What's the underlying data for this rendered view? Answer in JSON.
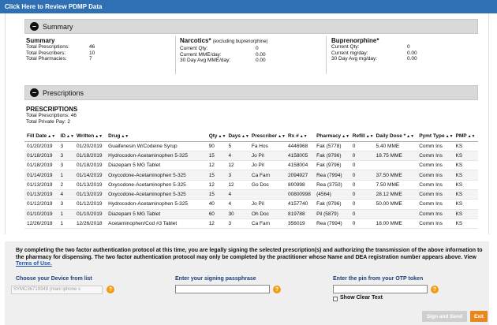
{
  "header": {
    "title": "Click Here to Review PDMP Data"
  },
  "summary_section": {
    "label": "Summary",
    "summary": {
      "title": "Summary",
      "rows": [
        {
          "k": "Total Prescriptions:",
          "v": "46"
        },
        {
          "k": "Total Prescribers:",
          "v": "10"
        },
        {
          "k": "Total Pharmacies:",
          "v": "7"
        }
      ]
    },
    "narcotics": {
      "title": "Narcotics*",
      "note": "(excluding buprenorphine)",
      "rows": [
        {
          "k": "Current Qty:",
          "v": "0"
        },
        {
          "k": "Current MME/day:",
          "v": "0.00"
        },
        {
          "k": "30 Day Avg MME/day:",
          "v": "0.00"
        }
      ]
    },
    "buprenorphine": {
      "title": "Buprenorphine*",
      "rows": [
        {
          "k": "Current Qty:",
          "v": "0"
        },
        {
          "k": "Current mg/day:",
          "v": "0.00"
        },
        {
          "k": "30 Day Avg mg/day:",
          "v": "0.00"
        }
      ]
    }
  },
  "prescriptions_section": {
    "label": "Prescriptions",
    "title": "PRESCRIPTIONS",
    "total_prescriptions": "Total Prescriptions: 46",
    "total_private_pay": "Total Private Pay:  2",
    "columns": [
      "Fill Date",
      "ID",
      "Written",
      "Drug",
      "Qty",
      "Days",
      "Prescriber",
      "Rx #",
      "Pharmacy",
      "Refill",
      "Daily Dose *",
      "Pymt Type",
      "PMP"
    ],
    "rows": [
      [
        "01/20/2019",
        "3",
        "01/20/2019",
        "Guaifenesin W/Codeine Syrup",
        "90",
        "5",
        "Fa Hos",
        "4446968",
        "Fak (5778)",
        "0",
        "5.40 MME",
        "Comm Ins",
        "KS"
      ],
      [
        "01/18/2019",
        "3",
        "01/18/2019",
        "Hydrocodon-Acetaminophen 5-325",
        "15",
        "4",
        "Jo Pil",
        "4158005",
        "Fak (9796)",
        "0",
        "18.75 MME",
        "Comm Ins",
        "KS"
      ],
      [
        "01/18/2019",
        "3",
        "01/18/2019",
        "Diazepam 5 MG Tablet",
        "12",
        "12",
        "Jo Pil",
        "4158004",
        "Fak (9796)",
        "0",
        "",
        "Comm Ins",
        "KS"
      ],
      [
        "01/14/2019",
        "1",
        "01/14/2019",
        "Oxycodone-Acetaminophen 5-325",
        "15",
        "3",
        "Ca Fam",
        "2094927",
        "Rea (7994)",
        "0",
        "37.50 MME",
        "Comm Ins",
        "KS"
      ],
      [
        "01/13/2019",
        "2",
        "01/13/2019",
        "Oxycodone-Acetaminophen 5-325",
        "12",
        "12",
        "Go Doc",
        "800998",
        "Rea (3750)",
        "0",
        "7.50 MME",
        "Comm Ins",
        "KS"
      ],
      [
        "01/13/2019",
        "4",
        "01/13/2019",
        "Oxycodone-Acetaminophen 5-325",
        "15",
        "4",
        "",
        "00800998",
        "(4564)",
        "0",
        "28.12 MME",
        "Comm Ins",
        "KS"
      ],
      [
        "01/12/2019",
        "3",
        "01/12/2019",
        "Hydrocodon-Acetaminophen 5-325",
        "40",
        "4",
        "Jo Pil",
        "4157740",
        "Fak (9796)",
        "0",
        "50.00 MME",
        "Comm Ins",
        "KS"
      ],
      [
        "01/10/2019",
        "1",
        "01/10/2019",
        "Diazepam 5 MG Tablet",
        "60",
        "30",
        "Oh Doc",
        "819788",
        "Pil (5879)",
        "0",
        "",
        "Comm Ins",
        "KS"
      ],
      [
        "12/26/2018",
        "1",
        "12/26/2018",
        "Acetaminophen/Cod #3 Tablet",
        "12",
        "3",
        "Ca Fam",
        "356019",
        "Rea (7994)",
        "0",
        "18.00 MME",
        "Comm Ins",
        "KS"
      ]
    ]
  },
  "auth": {
    "disclaimer": "By completing the two factor authentication protocol at this time, you are legally signing the selected prescription(s) and authorizing the transmission of the above information to the pharmacy for dispensing. The two factor authentication protocol may only be completed by the practitioner whose Name and DEA registration number appears above. View ",
    "terms_link": "Terms of Use.",
    "device_label": "Choose your Device from list",
    "device_value": "SYMC36719349 (mani iphone s",
    "passphrase_label": "Enter your signing passphrase",
    "otp_label": "Enter the pin from your OTP token",
    "show_clear_text": "Show Clear Text",
    "sign_button": "Sign and Send",
    "exit_button": "Exit"
  },
  "colors": {
    "header_blue": "#2f6fb4",
    "help_orange": "#f39c12",
    "exit_orange": "#e8871e",
    "link_blue": "#2456a6"
  }
}
